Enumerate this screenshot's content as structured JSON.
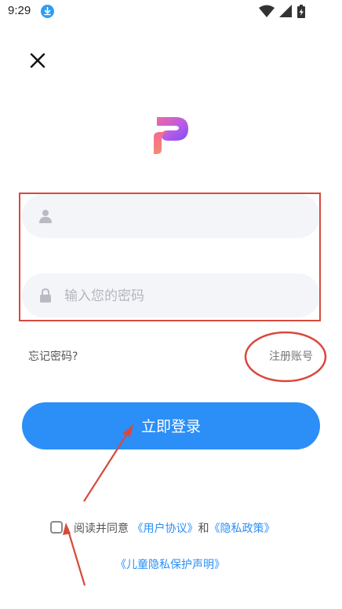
{
  "status_bar": {
    "time": "9:29"
  },
  "form": {
    "username_placeholder": "",
    "password_placeholder": "输入您的密码"
  },
  "links": {
    "forgot": "忘记密码?",
    "register": "注册账号"
  },
  "login_button": "立即登录",
  "agreement": {
    "prefix": "阅读并同意",
    "user_agreement": "《用户协议》",
    "and": "和",
    "privacy_policy": "《隐私政策》",
    "children_privacy": "《儿童隐私保护声明》"
  },
  "colors": {
    "primary": "#2b8ff7",
    "annotation": "#d8493c",
    "field_bg": "#f4f5f9"
  }
}
